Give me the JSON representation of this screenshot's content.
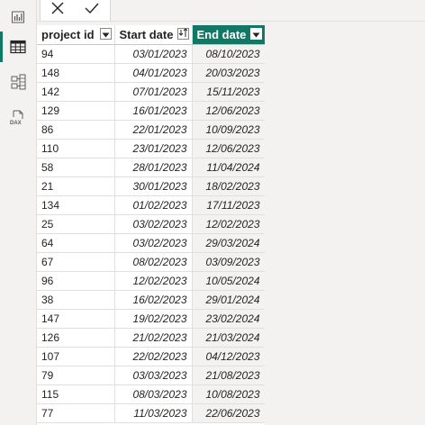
{
  "nav": {
    "items": [
      {
        "name": "report-view",
        "icon": "bar-chart-icon"
      },
      {
        "name": "table-view",
        "icon": "table-grid-icon"
      },
      {
        "name": "model-view",
        "icon": "model-icon"
      },
      {
        "name": "dax-query-view",
        "icon": "dax-icon"
      }
    ],
    "active": "table-view",
    "dax_label": "DAX"
  },
  "toolbar": {
    "cancel_icon": "close-icon",
    "commit_icon": "check-icon"
  },
  "table": {
    "columns": [
      {
        "label": "project id",
        "control": "dropdown"
      },
      {
        "label": "Start date",
        "control": "sort-ascending"
      },
      {
        "label": "End date",
        "control": "dropdown"
      }
    ],
    "selected_column": "End date",
    "rows": [
      [
        "94",
        "03/01/2023",
        "08/10/2023"
      ],
      [
        "148",
        "04/01/2023",
        "20/03/2023"
      ],
      [
        "142",
        "07/01/2023",
        "15/11/2023"
      ],
      [
        "129",
        "16/01/2023",
        "12/06/2023"
      ],
      [
        "86",
        "22/01/2023",
        "10/09/2023"
      ],
      [
        "110",
        "23/01/2023",
        "12/06/2023"
      ],
      [
        "58",
        "28/01/2023",
        "11/04/2024"
      ],
      [
        "21",
        "30/01/2023",
        "18/02/2023"
      ],
      [
        "134",
        "01/02/2023",
        "17/11/2023"
      ],
      [
        "25",
        "03/02/2023",
        "12/02/2023"
      ],
      [
        "64",
        "03/02/2023",
        "29/03/2024"
      ],
      [
        "67",
        "08/02/2023",
        "03/09/2023"
      ],
      [
        "96",
        "12/02/2023",
        "10/05/2024"
      ],
      [
        "38",
        "16/02/2023",
        "29/01/2024"
      ],
      [
        "147",
        "19/02/2023",
        "23/02/2024"
      ],
      [
        "126",
        "21/02/2023",
        "21/03/2024"
      ],
      [
        "107",
        "22/02/2023",
        "04/12/2023"
      ],
      [
        "79",
        "03/03/2023",
        "21/08/2023"
      ],
      [
        "115",
        "08/03/2023",
        "10/08/2023"
      ],
      [
        "77",
        "11/03/2023",
        "22/06/2023"
      ]
    ]
  },
  "colors": {
    "accent": "#117865",
    "background": "#f3f2f1",
    "grid": "#e1dfdd"
  }
}
